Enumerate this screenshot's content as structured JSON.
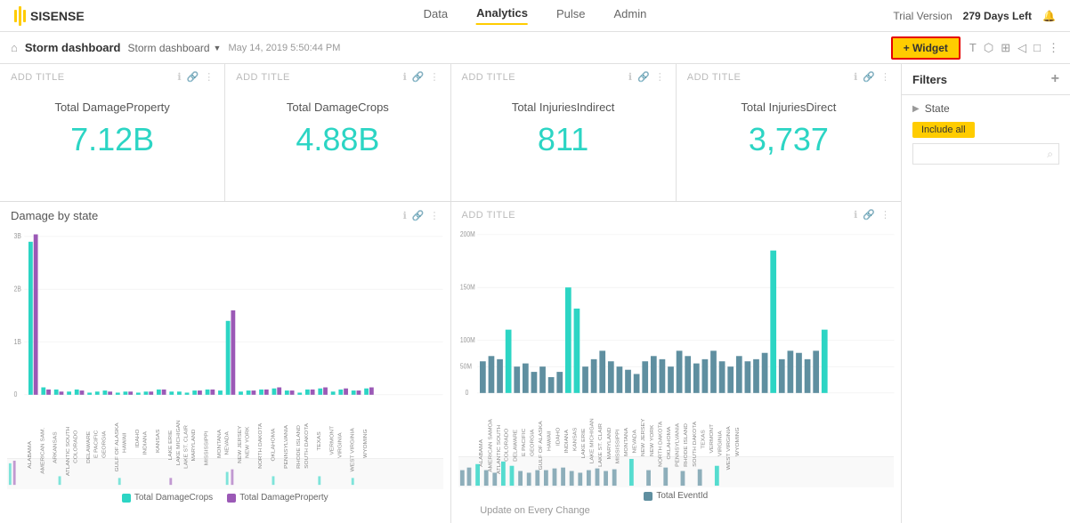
{
  "nav": {
    "logo": "SISENSE",
    "links": [
      "Data",
      "Analytics",
      "Pulse",
      "Admin"
    ],
    "active_link": "Analytics",
    "trial": "Trial Version",
    "days_left": "279 Days Left"
  },
  "subheader": {
    "dashboard_title": "Storm dashboard",
    "breadcrumb": "Storm dashboard",
    "date": "May 14, 2019 5:50:44 PM",
    "add_widget": "+ Widget"
  },
  "kpi_cards": [
    {
      "add_title": "ADD TITLE",
      "label": "Total DamageProperty",
      "value": "7.12B"
    },
    {
      "add_title": "ADD TITLE",
      "label": "Total DamageCrops",
      "value": "4.88B"
    },
    {
      "add_title": "ADD TITLE",
      "label": "Total InjuriesIndirect",
      "value": "811"
    },
    {
      "add_title": "ADD TITLE",
      "label": "Total InjuriesDirect",
      "value": "3,737"
    }
  ],
  "chart_left": {
    "title": "Damage by state",
    "add_title": "ADD TITLE",
    "legend": [
      {
        "label": "Total DamageCrops",
        "color": "#2cd5c4"
      },
      {
        "label": "Total DamageProperty",
        "color": "#9b59b6"
      }
    ]
  },
  "chart_right": {
    "add_title": "ADD TITLE",
    "legend": [
      {
        "label": "Total EventId",
        "color": "#5f8fa0"
      }
    ]
  },
  "filters": {
    "title": "Filters",
    "state_label": "State",
    "include_all": "Include all",
    "update_text": "Update on Every Change"
  },
  "toolbar_icons": [
    "T",
    "⬡",
    "⊞",
    "◁",
    "□",
    "⋮"
  ],
  "icons": {
    "info": "ℹ",
    "link": "🔗",
    "more": "⋮",
    "bell": "🔔",
    "chevron_right": "▶",
    "chevron_down": "▼",
    "search": "⌕",
    "plus": "+",
    "pencil": "✎",
    "home": "⌂",
    "filter_icon": "◨"
  }
}
